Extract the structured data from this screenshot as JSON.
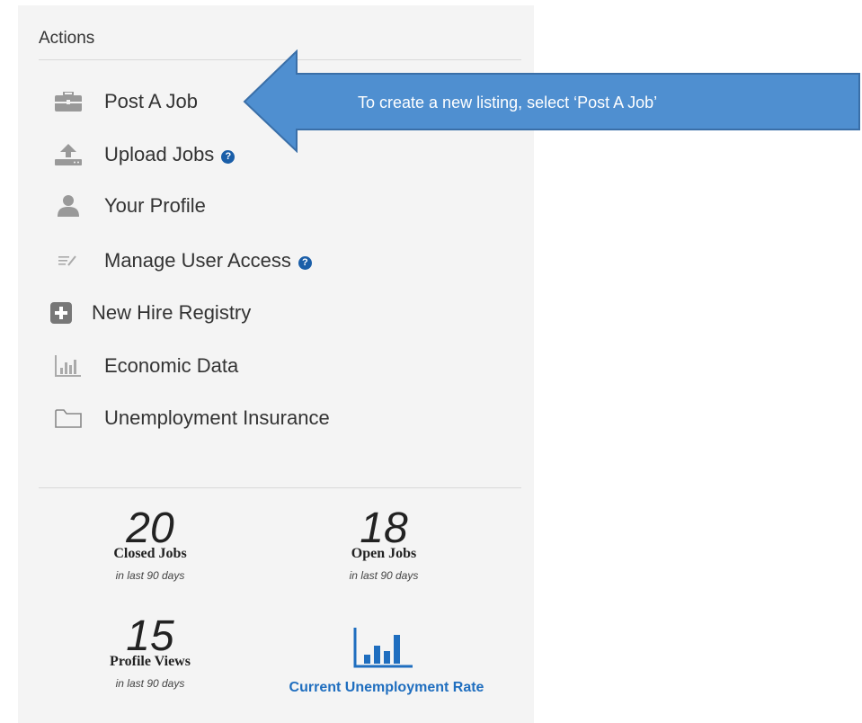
{
  "actions": {
    "title": "Actions",
    "items": [
      {
        "label": "Post A Job",
        "icon": "briefcase-icon"
      },
      {
        "label": "Upload Jobs",
        "icon": "upload-icon",
        "help": "?"
      },
      {
        "label": "Your Profile",
        "icon": "user-icon"
      },
      {
        "label": "Manage User Access",
        "icon": "edit-list-icon",
        "help": "?"
      },
      {
        "label": "New Hire Registry",
        "icon": "plus-square-icon"
      },
      {
        "label": "Economic Data",
        "icon": "bar-chart-icon"
      },
      {
        "label": "Unemployment Insurance",
        "icon": "folder-icon"
      }
    ]
  },
  "stats": [
    {
      "value": "20",
      "label": "Closed Jobs",
      "sub": "in last 90 days"
    },
    {
      "value": "18",
      "label": "Open Jobs",
      "sub": "in last 90 days"
    },
    {
      "value": "15",
      "label": "Profile Views",
      "sub": "in last 90 days"
    }
  ],
  "unemployment": {
    "label": "Current Unemployment Rate",
    "icon": "bar-chart-icon"
  },
  "callout": {
    "text": "To create a new listing, select ‘Post A Job’"
  },
  "colors": {
    "accent": "#1f6ebf",
    "callout_fill": "#4f8fd0",
    "callout_border": "#3a6fa8",
    "panel_bg": "#f4f4f4"
  }
}
